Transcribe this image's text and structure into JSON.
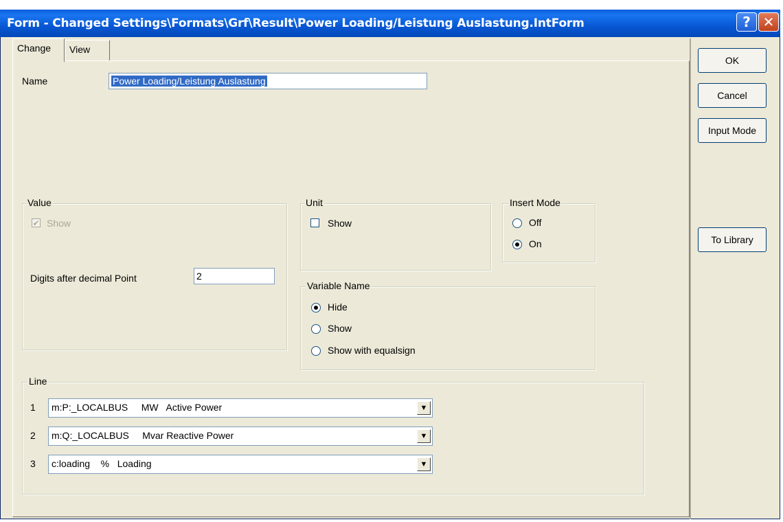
{
  "window": {
    "title": "Form - Changed Settings\\Formats\\Grf\\Result\\Power Loading/Leistung  Auslastung.IntForm",
    "help_glyph": "?",
    "close_glyph": "✕"
  },
  "tabs": [
    {
      "label": "Change",
      "active": true
    },
    {
      "label": "View",
      "active": false
    }
  ],
  "buttons": {
    "ok": "OK",
    "cancel": "Cancel",
    "input_mode": "Input Mode",
    "to_library": "To Library"
  },
  "name": {
    "label": "Name",
    "value": "Power Loading/Leistung  Auslastung"
  },
  "value_group": {
    "legend": "Value",
    "show_label": "Show",
    "show_checked": true,
    "show_disabled": true,
    "digits_label": "Digits after decimal Point",
    "digits_value": "2"
  },
  "unit_group": {
    "legend": "Unit",
    "show_label": "Show",
    "show_checked": false
  },
  "insert_mode_group": {
    "legend": "Insert Mode",
    "options": [
      {
        "label": "Off",
        "selected": false
      },
      {
        "label": "On",
        "selected": true
      }
    ]
  },
  "variable_name_group": {
    "legend": "Variable Name",
    "options": [
      {
        "label": "Hide",
        "selected": true
      },
      {
        "label": "Show",
        "selected": false
      },
      {
        "label": "Show with equalsign",
        "selected": false
      }
    ]
  },
  "line_group": {
    "legend": "Line",
    "rows": [
      {
        "num": "1",
        "value": "m:P:_LOCALBUS     MW   Active Power"
      },
      {
        "num": "2",
        "value": "m:Q:_LOCALBUS     Mvar Reactive Power"
      },
      {
        "num": "3",
        "value": "c:loading    %   Loading"
      }
    ]
  }
}
